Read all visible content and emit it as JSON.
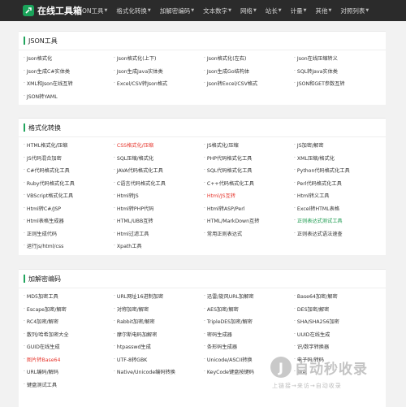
{
  "app": {
    "logo_text": "在线工具箱",
    "nav": [
      "JSON工具",
      "格式化转换",
      "加解密编码",
      "文本数字",
      "网络",
      "站长",
      "计量",
      "其他",
      "对照列表"
    ]
  },
  "sections": [
    {
      "title": "JSON工具",
      "items": [
        {
          "label": "Json格式化"
        },
        {
          "label": "Json格式化(上下)"
        },
        {
          "label": "Json格式化(左右)"
        },
        {
          "label": "Json在线压缩转义"
        },
        {
          "label": "Json生成C#实体类"
        },
        {
          "label": "Json生成Java实体类"
        },
        {
          "label": "Json生成Go结构体"
        },
        {
          "label": "SQL转Java实体类"
        },
        {
          "label": "XML和Json在线互转"
        },
        {
          "label": "Excel/CSV转Json格式"
        },
        {
          "label": "Json转Excel/CSV格式"
        },
        {
          "label": "JSON和GET参数互转"
        },
        {
          "label": "JSON转YAML"
        }
      ]
    },
    {
      "title": "格式化转换",
      "items": [
        {
          "label": "HTML格式化/压缩"
        },
        {
          "label": "CSS格式化/压缩",
          "color": "red"
        },
        {
          "label": "JS格式化/压缩"
        },
        {
          "label": "JS加密/解密"
        },
        {
          "label": "JS代码混合加密"
        },
        {
          "label": "SQL压缩/格式化"
        },
        {
          "label": "PHP代码格式化工具"
        },
        {
          "label": "XML压缩/格式化"
        },
        {
          "label": "C#代码格式化工具"
        },
        {
          "label": "JAVA代码格式化工具"
        },
        {
          "label": "SQL代码格式化工具"
        },
        {
          "label": "Python代码格式化工具"
        },
        {
          "label": "Ruby代码格式化工具"
        },
        {
          "label": "C语言代码格式化工具"
        },
        {
          "label": "C++代码格式化工具"
        },
        {
          "label": "Perl代码格式化工具"
        },
        {
          "label": "VBScript格式化工具"
        },
        {
          "label": "Html转JS"
        },
        {
          "label": "Html/JS互转",
          "color": "red"
        },
        {
          "label": "Html转义工具"
        },
        {
          "label": "Html转C#/JSP"
        },
        {
          "label": "Html转PHP代码"
        },
        {
          "label": "Html转ASP/Perl"
        },
        {
          "label": "Excel转HTML表格"
        },
        {
          "label": "Html表格生成器"
        },
        {
          "label": "HTML/UBB互转"
        },
        {
          "label": "HTML/MarkDown互转"
        },
        {
          "label": "正则表达式测试工具",
          "color": "green"
        },
        {
          "label": "正则生成代码"
        },
        {
          "label": "Html过滤工具"
        },
        {
          "label": "常用正则表达式"
        },
        {
          "label": "正则表达式语法速查"
        },
        {
          "label": "运行js/html/css"
        },
        {
          "label": "Xpath工具"
        }
      ]
    },
    {
      "title": "加解密编码",
      "items": [
        {
          "label": "MD5加密工具"
        },
        {
          "label": "URL网址16进制加密"
        },
        {
          "label": "迅雷/旋风URL加解密"
        },
        {
          "label": "Base64加密/解密"
        },
        {
          "label": "Escape加密/解密"
        },
        {
          "label": "对称加密/解密"
        },
        {
          "label": "AES加密/解密"
        },
        {
          "label": "DES加密/解密"
        },
        {
          "label": "RC4加密/解密"
        },
        {
          "label": "Rabbit加密/解密"
        },
        {
          "label": "TripleDES加密/解密"
        },
        {
          "label": "SHA/SHA256加密"
        },
        {
          "label": "散列/哈希加密大全"
        },
        {
          "label": "摩尔斯电码加解密"
        },
        {
          "label": "密码生成器"
        },
        {
          "label": "UUID在线生成"
        },
        {
          "label": "GUID在线生成"
        },
        {
          "label": "htpasswd生成"
        },
        {
          "label": "条形码生成器"
        },
        {
          "label": "识/数字转换器"
        },
        {
          "label": "图片转Base64",
          "color": "red"
        },
        {
          "label": "UTF-8转GBK"
        },
        {
          "label": "Unicode/ASCII转换"
        },
        {
          "label": "电子码/转码"
        },
        {
          "label": "URL编码/解码"
        },
        {
          "label": "Native/Unicode编码转换"
        },
        {
          "label": "KeyCode键盘按键码"
        },
        {
          "label": "颜色"
        },
        {
          "label": "键盘测试工具"
        }
      ]
    }
  ],
  "watermark": {
    "title": "自动秒收录",
    "subtitle": "上链接→来访→自动收录"
  }
}
